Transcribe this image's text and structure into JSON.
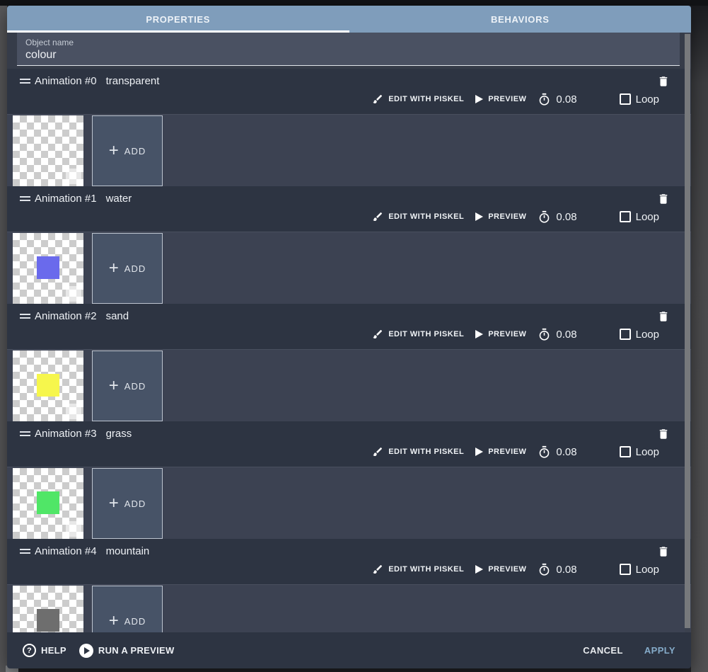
{
  "tabs": {
    "properties": "PROPERTIES",
    "behaviors": "BEHAVIORS"
  },
  "object_name": {
    "label": "Object name",
    "value": "colour"
  },
  "animations": [
    {
      "index_label": "Animation #0",
      "name": "transparent",
      "frame_color": null
    },
    {
      "index_label": "Animation #1",
      "name": "water",
      "frame_color": "#6a6aec"
    },
    {
      "index_label": "Animation #2",
      "name": "sand",
      "frame_color": "#f6f64c"
    },
    {
      "index_label": "Animation #3",
      "name": "grass",
      "frame_color": "#50e667"
    },
    {
      "index_label": "Animation #4",
      "name": "mountain",
      "frame_color": "#6e6e6e"
    }
  ],
  "animation_controls": {
    "edit": "EDIT WITH PISKEL",
    "preview": "PREVIEW",
    "time": "0.08",
    "loop": "Loop",
    "add": "ADD"
  },
  "footer": {
    "help": "HELP",
    "run_preview": "RUN A PREVIEW",
    "cancel": "CANCEL",
    "apply": "APPLY"
  },
  "icons": {
    "plus": "+",
    "question": "?",
    "drag": "drag-handle",
    "trash": "trash-can",
    "brush": "paintbrush",
    "play": "play-triangle",
    "stopwatch": "timer",
    "checkbox": "checkbox-unchecked",
    "play_circle": "play-circle"
  },
  "colors": {
    "tab_bar": "#7f9dbb",
    "header_band": "#2d3442",
    "frames_band": "#3c4252",
    "name_panel": "#4a5162",
    "add_button": "#475367",
    "apply": "#85abc9"
  }
}
